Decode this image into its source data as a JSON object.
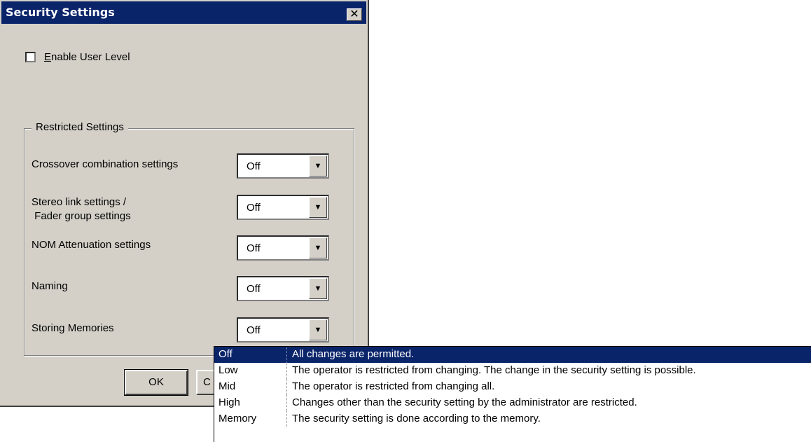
{
  "window": {
    "title": "Security Settings",
    "close_label": "✕"
  },
  "enable_user_level": {
    "label_first": "E",
    "label_rest": "nable User Level",
    "checked": false
  },
  "group": {
    "legend": "Restricted Settings"
  },
  "rows": [
    {
      "label_line1": "Crossover combination settings",
      "label_line2": "",
      "value": "Off"
    },
    {
      "label_line1": "Stereo link settings /",
      "label_line2": " Fader group settings",
      "value": "Off"
    },
    {
      "label_line1": "NOM Attenuation settings",
      "label_line2": "",
      "value": "Off"
    },
    {
      "label_line1": "Naming",
      "label_line2": "",
      "value": "Off"
    },
    {
      "label_line1": "Storing Memories",
      "label_line2": "",
      "value": "Off"
    }
  ],
  "buttons": {
    "ok": "OK",
    "cancel_partial": "C"
  },
  "dropdown": {
    "options": [
      {
        "key": "Off",
        "desc": "All changes are permitted.",
        "selected": true
      },
      {
        "key": "Low",
        "desc": "The operator is restricted from changing. The change in the security setting is possible."
      },
      {
        "key": "Mid",
        "desc": "The operator is restricted from changing all."
      },
      {
        "key": "High",
        "desc": "Changes other than the security setting by the administrator are restricted."
      },
      {
        "key": "Memory",
        "desc": "The security setting is done according to the memory."
      }
    ]
  },
  "colors": {
    "titlebar": "#0a246a",
    "dialog_bg": "#d4d0c8",
    "selection": "#0a246a"
  }
}
